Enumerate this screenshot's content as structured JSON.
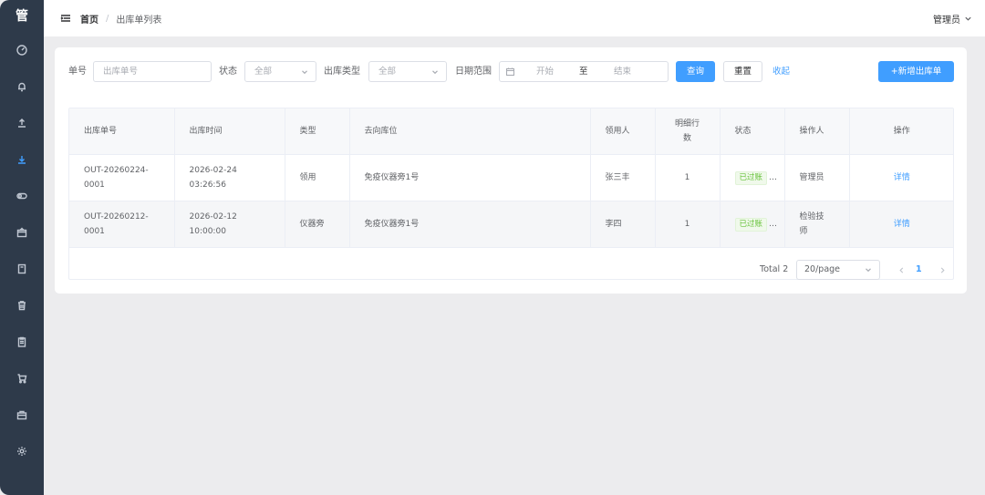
{
  "sidebar": {
    "logo": "管",
    "items": [
      {
        "icon": "dashboard-icon"
      },
      {
        "icon": "bell-icon"
      },
      {
        "icon": "upload-icon"
      },
      {
        "icon": "download-icon",
        "active": true
      },
      {
        "icon": "toggle-icon"
      },
      {
        "icon": "box-icon"
      },
      {
        "icon": "book-icon"
      },
      {
        "icon": "trash-icon"
      },
      {
        "icon": "clipboard-icon"
      },
      {
        "icon": "cart-icon"
      },
      {
        "icon": "briefcase-icon"
      },
      {
        "icon": "settings-icon"
      }
    ]
  },
  "header": {
    "breadcrumb_home": "首页",
    "breadcrumb_sep": "/",
    "breadcrumb_current": "出库单列表",
    "user": "管理员"
  },
  "filters": {
    "order_no_label": "单号",
    "order_no_placeholder": "出库单号",
    "status_label": "状态",
    "status_value": "全部",
    "type_label": "出库类型",
    "type_value": "全部",
    "date_label": "日期范围",
    "date_start": "开始",
    "date_to": "至",
    "date_end": "结束",
    "query_button": "查询",
    "reset_button": "重置",
    "collapse_link": "收起",
    "add_button": "+新增出库单"
  },
  "table": {
    "columns": [
      "出库单号",
      "出库时间",
      "类型",
      "去向库位",
      "领用人",
      "明细行数",
      "状态",
      "操作人",
      "操作"
    ],
    "rows": [
      {
        "order_no": "OUT-20260224-0001",
        "time": "2026-02-24 03:26:56",
        "type": "领用",
        "location": "免疫仪器旁1号",
        "receiver": "张三丰",
        "lines": "1",
        "status": "已过账",
        "operator": "管理员",
        "action": "详情"
      },
      {
        "order_no": "OUT-20260212-0001",
        "time": "2026-02-12 10:00:00",
        "type": "仪器旁",
        "location": "免疫仪器旁1号",
        "receiver": "李四",
        "lines": "1",
        "status": "已过账",
        "operator": "检验技师",
        "action": "详情"
      }
    ]
  },
  "pagination": {
    "total": "Total 2",
    "page_size": "20/page",
    "current_page": "1"
  },
  "colors": {
    "sidebar_bg": "#2e3a4a",
    "primary": "#409eff",
    "success": "#67c23a"
  }
}
